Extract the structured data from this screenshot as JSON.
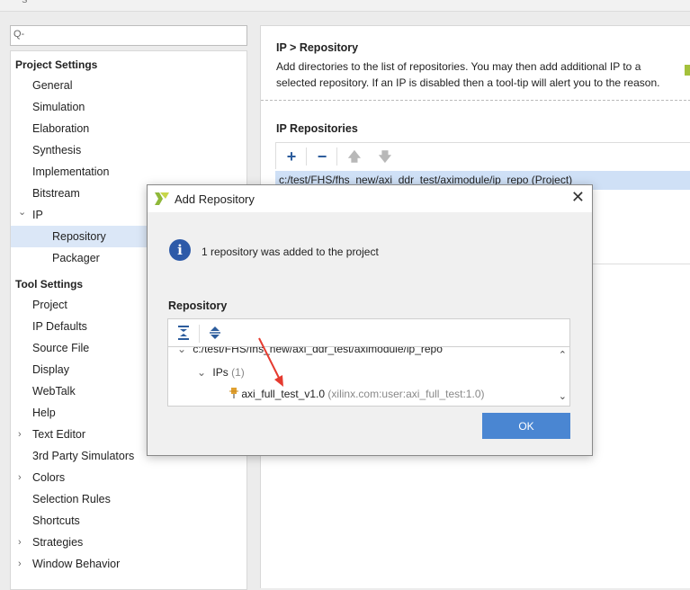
{
  "left": {
    "sections": [
      {
        "title": "Project Settings",
        "items": [
          {
            "label": "General"
          },
          {
            "label": "Simulation"
          },
          {
            "label": "Elaboration"
          },
          {
            "label": "Synthesis"
          },
          {
            "label": "Implementation"
          },
          {
            "label": "Bitstream"
          },
          {
            "label": "IP",
            "expanded": true
          },
          {
            "label": "Repository",
            "selected": true
          },
          {
            "label": "Packager"
          }
        ]
      },
      {
        "title": "Tool Settings",
        "items": [
          {
            "label": "Project"
          },
          {
            "label": "IP Defaults"
          },
          {
            "label": "Source File"
          },
          {
            "label": "Display"
          },
          {
            "label": "WebTalk"
          },
          {
            "label": "Help"
          },
          {
            "label": "Text Editor",
            "collapsed": true
          },
          {
            "label": "3rd Party Simulators"
          },
          {
            "label": "Colors",
            "collapsed": true
          },
          {
            "label": "Selection Rules"
          },
          {
            "label": "Shortcuts"
          },
          {
            "label": "Strategies",
            "collapsed": true
          },
          {
            "label": "Window Behavior",
            "collapsed": true
          }
        ]
      }
    ]
  },
  "search": {
    "placeholder": "Q-"
  },
  "right": {
    "title": "IP > Repository",
    "description": "Add directories to the list of repositories. You may then add additional IP to a selected repository. If an IP is disabled then a tool-tip will alert you to the reason.",
    "repos_label": "IP Repositories",
    "repo_row": "c:/test/FHS/fhs_new/axi_ddr_test/aximodule/ip_repo (Project)"
  },
  "dialog": {
    "title": "Add Repository",
    "info": "1 repository was added to the project",
    "repository_label": "Repository",
    "tree": {
      "path": "c:/test/FHS/fhs_new/axi_ddr_test/aximodule/ip_repo",
      "ips_label": "IPs",
      "ips_count": "(1)",
      "ip_name": "axi_full_test_v1.0",
      "ip_vlnv": "(xilinx.com:user:axi_full_test:1.0)"
    },
    "ok_label": "OK"
  },
  "colors": {
    "accent": "#4a86d2",
    "selection": "#dbe7f7",
    "info": "#2d5aa8",
    "arrow": "#e53a2f"
  }
}
